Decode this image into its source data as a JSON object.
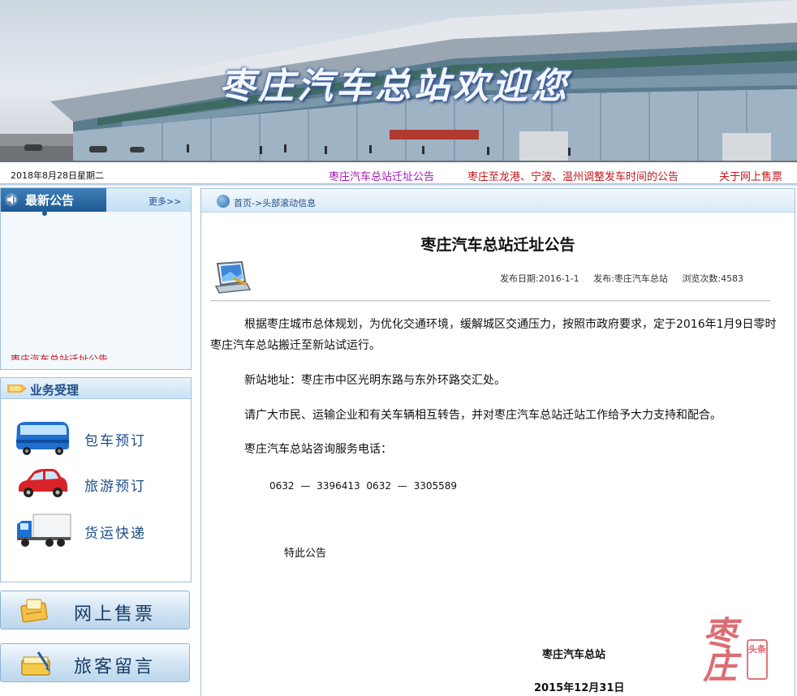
{
  "banner": {
    "title": "枣庄汽车总站欢迎您"
  },
  "top": {
    "date": "2018年8月28日星期二",
    "links": [
      {
        "label": "枣庄汽车总站迁址公告"
      },
      {
        "label": "枣庄至龙港、宁波、温州调整发车时间的公告"
      },
      {
        "label": "关于网上售票"
      }
    ]
  },
  "news": {
    "title": "最新公告",
    "more": "更多>>",
    "scrolling_item": "枣庄汽车总站迁址公告"
  },
  "services": {
    "title": "业务受理",
    "items": [
      {
        "label": "包车预订",
        "icon": "bus-icon"
      },
      {
        "label": "旅游预订",
        "icon": "car-icon"
      },
      {
        "label": "货运快递",
        "icon": "truck-icon"
      }
    ]
  },
  "big_buttons": [
    {
      "label": "网上售票",
      "icon": "ticket-icon"
    },
    {
      "label": "旅客留言",
      "icon": "message-icon"
    }
  ],
  "breadcrumb": "首页->头部滚动信息",
  "article": {
    "title": "枣庄汽车总站迁址公告",
    "meta": {
      "date": "发布日期:2016-1-1",
      "publisher": "发布:枣庄汽车总站",
      "views": "浏览次数:4583"
    },
    "paragraphs": [
      "根据枣庄城市总体规划，为优化交通环境，缓解城区交通压力，按照市政府要求，定于2016年1月9日零时枣庄汽车总站搬迁至新站试运行。",
      "新站地址：枣庄市中区光明东路与东外环路交汇处。",
      "请广大市民、运输企业和有关车辆相互转告，并对枣庄汽车总站迁站工作给予大力支持和配合。",
      "枣庄汽车总站咨询服务电话：",
      "0632 — 3396413  0632 — 3305589",
      "特此公告"
    ],
    "signature_org": "枣庄汽车总站",
    "signature_date": "2015年12月31日"
  },
  "watermark": {
    "main": "枣庄",
    "seal": "头条"
  },
  "colors": {
    "link_red": "#c4161c",
    "link_purple": "#a216b6",
    "nav_blue": "#1d5994",
    "text_blue": "#1d4e86"
  }
}
